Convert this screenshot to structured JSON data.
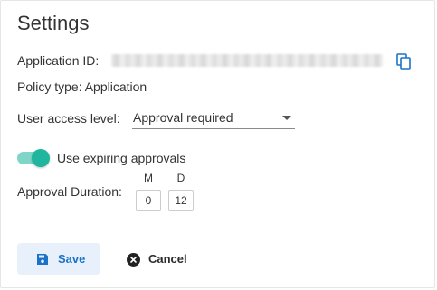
{
  "page": {
    "title": "Settings"
  },
  "app_id": {
    "label": "Application ID:",
    "copy_icon": "copy-icon"
  },
  "policy": {
    "label": "Policy type: Application"
  },
  "access": {
    "label": "User access level:",
    "selected": "Approval required"
  },
  "expiring": {
    "label": "Use expiring approvals",
    "enabled": true
  },
  "duration": {
    "label": "Approval Duration:",
    "months_header": "M",
    "days_header": "D",
    "months_value": "0",
    "days_value": "12"
  },
  "actions": {
    "save_label": "Save",
    "cancel_label": "Cancel"
  },
  "colors": {
    "accent": "#1a73c9",
    "toggle_track": "#7fd6c8",
    "toggle_thumb": "#1fb59e",
    "save_bg": "#e8f1fb"
  }
}
